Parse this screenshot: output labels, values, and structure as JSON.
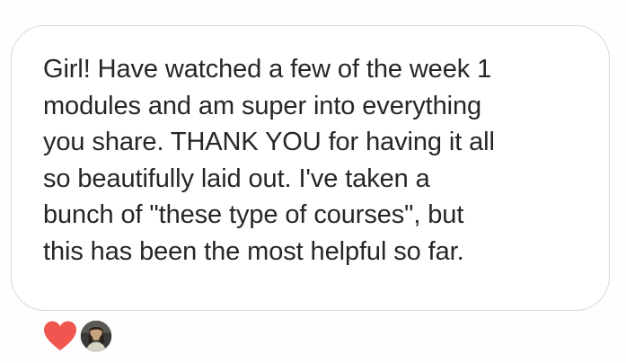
{
  "message": {
    "lines": [
      "Girl! Have watched a few of the week 1",
      "modules and am super into everything",
      "you share. THANK YOU for having it all",
      "so beautifully laid out. I've taken a",
      "bunch of \"these type of courses\", but",
      "this has been the most helpful so far."
    ]
  },
  "reactions": {
    "heart_icon": "heart-icon",
    "heart_color": "#f0554f",
    "avatar_icon": "avatar"
  },
  "colors": {
    "text": "#262626",
    "bubble_border": "#d9d9d9",
    "background": "#ffffff"
  }
}
